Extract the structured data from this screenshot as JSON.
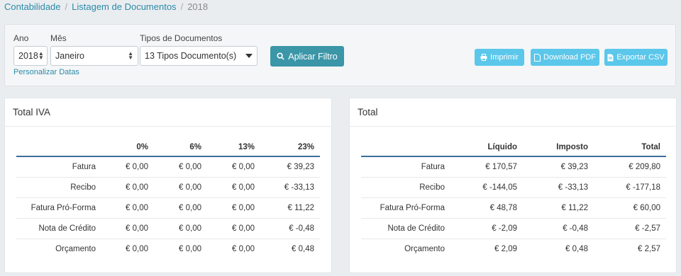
{
  "breadcrumb": {
    "item1": "Contabilidade",
    "item2": "Listagem de Documentos",
    "item3": "2018",
    "separator": "/"
  },
  "filters": {
    "ano_label": "Ano",
    "ano_value": "2018",
    "mes_label": "Mês",
    "mes_value": "Janeiro",
    "tipos_label": "Tipos de Documentos",
    "tipos_value": "13 Tipos Documento(s)",
    "personalizar": "Personalizar Datas",
    "apply_label": "Aplicar Filtro"
  },
  "actions": {
    "print_label": "Imprimir",
    "pdf_label": "Download PDF",
    "csv_label": "Exportar CSV"
  },
  "iva_card": {
    "title": "Total IVA",
    "headers": [
      "",
      "0%",
      "6%",
      "13%",
      "23%"
    ],
    "rows": [
      [
        "Fatura",
        "€ 0,00",
        "€ 0,00",
        "€ 0,00",
        "€ 39,23"
      ],
      [
        "Recibo",
        "€ 0,00",
        "€ 0,00",
        "€ 0,00",
        "€ -33,13"
      ],
      [
        "Fatura Pró-Forma",
        "€ 0,00",
        "€ 0,00",
        "€ 0,00",
        "€ 11,22"
      ],
      [
        "Nota de Crédito",
        "€ 0,00",
        "€ 0,00",
        "€ 0,00",
        "€ -0,48"
      ],
      [
        "Orçamento",
        "€ 0,00",
        "€ 0,00",
        "€ 0,00",
        "€ 0,48"
      ]
    ]
  },
  "total_card": {
    "title": "Total",
    "headers": [
      "",
      "Líquido",
      "Imposto",
      "Total"
    ],
    "rows": [
      [
        "Fatura",
        "€ 170,57",
        "€ 39,23",
        "€ 209,80"
      ],
      [
        "Recibo",
        "€ -144,05",
        "€ -33,13",
        "€ -177,18"
      ],
      [
        "Fatura Pró-Forma",
        "€ 48,78",
        "€ 11,22",
        "€ 60,00"
      ],
      [
        "Nota de Crédito",
        "€ -2,09",
        "€ -0,48",
        "€ -2,57"
      ],
      [
        "Orçamento",
        "€ 2,09",
        "€ 0,48",
        "€ 2,57"
      ]
    ]
  }
}
